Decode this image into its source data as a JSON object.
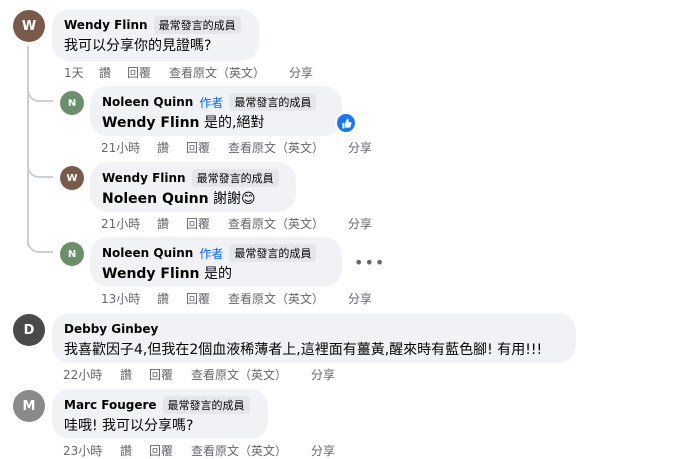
{
  "comments": [
    {
      "name": "Wendy Flinn",
      "badge": "最常發言的成員",
      "text": "我可以分享你的見證嗎?",
      "time": "1天",
      "actions": [
        "讚",
        "回覆",
        "查看原文（英文）",
        "分享"
      ]
    },
    {
      "name": "Noleen Quinn",
      "author": "作者",
      "badge": "最常發言的成員",
      "mention": "Wendy Flinn",
      "text": " 是的,絕對",
      "time": "21小時",
      "actions": [
        "讚",
        "回覆",
        "查看原文（英文）",
        "分享"
      ],
      "reaction_icon": "like-icon"
    },
    {
      "name": "Wendy Flinn",
      "badge": "最常發言的成員",
      "mention": "Noleen Quinn",
      "text": " 謝謝😊",
      "time": "21小時",
      "actions": [
        "讚",
        "回覆",
        "查看原文（英文）",
        "分享"
      ]
    },
    {
      "name": "Noleen Quinn",
      "author": "作者",
      "badge": "最常發言的成員",
      "mention": "Wendy Flinn",
      "text": " 是的",
      "time": "13小時",
      "actions": [
        "讚",
        "回覆",
        "查看原文（英文）",
        "分享"
      ],
      "more_icon": "more-horizontal-icon"
    },
    {
      "name": "Debby Ginbey",
      "text": "我喜歡因子4,但我在2個血液稀薄者上,這裡面有薑黃,醒來時有藍色腳! 有用!!!",
      "time": "22小時",
      "actions": [
        "讚",
        "回覆",
        "查看原文（英文）",
        "分享"
      ]
    },
    {
      "name": "Marc Fougere",
      "badge": "最常發言的成員",
      "text": "哇哦! 我可以分享嗎?",
      "time": "23小時",
      "actions": [
        "讚",
        "回覆",
        "查看原文（英文）",
        "分享"
      ]
    }
  ],
  "top_more": "• • •",
  "colors": {
    "bubble": "#f0f2f5",
    "meta_text": "#65676b",
    "author_blue": "#0866ff",
    "like_blue": "#1877f2"
  }
}
